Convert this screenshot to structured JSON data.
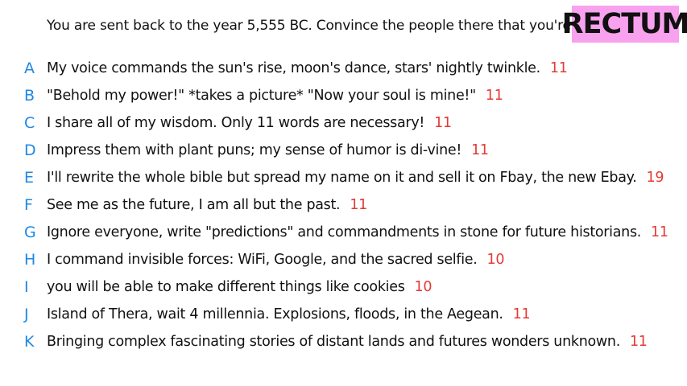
{
  "prompt": "You are sent back to the year 5,555 BC. Convince the people there that you're a god.",
  "badge": "RECTUM",
  "colors": {
    "letter": "#1e88e5",
    "score": "#e53935",
    "badge_bg": "#f7a1ef"
  },
  "answers": [
    {
      "letter": "A",
      "text": "My voice commands the sun's rise, moon's dance, stars' nightly twinkle.",
      "score": "11"
    },
    {
      "letter": "B",
      "text": "\"Behold my power!\" *takes a picture* \"Now your soul is mine!\"",
      "score": "11"
    },
    {
      "letter": "C",
      "text": "I share all of my wisdom. Only 11 words are necessary!",
      "score": "11"
    },
    {
      "letter": "D",
      "text": "Impress them with plant puns; my sense of humor is di-vine!",
      "score": "11"
    },
    {
      "letter": "E",
      "text": "I'll rewrite the whole bible but spread my name on it and sell it on Fbay, the new Ebay.",
      "score": "19"
    },
    {
      "letter": "F",
      "text": "See me as the future, I am all but the past.",
      "score": "11"
    },
    {
      "letter": "G",
      "text": "Ignore everyone, write \"predictions\" and commandments in stone for future historians.",
      "score": "11"
    },
    {
      "letter": "H",
      "text": "I command invisible forces: WiFi, Google, and the sacred selfie.",
      "score": "10"
    },
    {
      "letter": "I",
      "text": "you will be able to make different things like cookies",
      "score": "10"
    },
    {
      "letter": "J",
      "text": "Island of Thera, wait 4 millennia. Explosions, floods, in the Aegean.",
      "score": "11"
    },
    {
      "letter": "K",
      "text": "Bringing complex fascinating stories of distant lands and futures wonders unknown.",
      "score": "11"
    }
  ]
}
